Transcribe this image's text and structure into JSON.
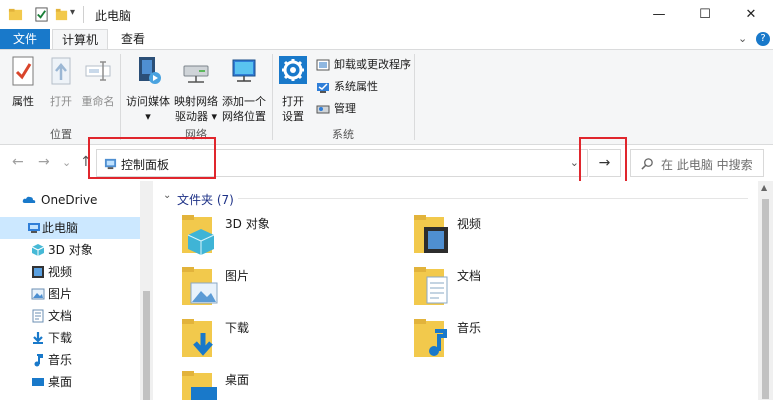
{
  "window": {
    "title": "此电脑",
    "minimize": "—",
    "maximize": "☐",
    "close": "✕"
  },
  "ribbon_tabs": {
    "file": "文件",
    "computer": "计算机",
    "view": "查看",
    "expand": "⌄",
    "help": "?"
  },
  "ribbon": {
    "location_group": {
      "label": "位置",
      "properties": "属性",
      "open": "打开",
      "rename": "重命名"
    },
    "network_group": {
      "label": "网络",
      "media_line1": "访问媒体",
      "media_line2": "▾",
      "map_line1": "映射网络",
      "map_line2": "驱动器 ▾",
      "add_line1": "添加一个",
      "add_line2": "网络位置"
    },
    "system_group": {
      "label": "系统",
      "settings_line1": "打开",
      "settings_line2": "设置",
      "uninstall": "卸载或更改程序",
      "sys_props": "系统属性",
      "manage": "管理"
    }
  },
  "navbar": {
    "back": "←",
    "forward": "→",
    "recent": "⌄",
    "up": "↑",
    "address": "控制面板",
    "address_dropdown": "⌄",
    "go": "→",
    "search_placeholder": "在 此电脑 中搜索"
  },
  "leftnav": {
    "items": [
      {
        "label": "OneDrive"
      },
      {
        "label": "此电脑"
      },
      {
        "label": "3D 对象"
      },
      {
        "label": "视频"
      },
      {
        "label": "图片"
      },
      {
        "label": "文档"
      },
      {
        "label": "下载"
      },
      {
        "label": "音乐"
      },
      {
        "label": "桌面"
      }
    ]
  },
  "content": {
    "group_header": "文件夹 (7)",
    "folders": [
      {
        "label": "3D 对象"
      },
      {
        "label": "视频"
      },
      {
        "label": "图片"
      },
      {
        "label": "文档"
      },
      {
        "label": "下载"
      },
      {
        "label": "音乐"
      },
      {
        "label": "桌面"
      }
    ]
  },
  "colors": {
    "accent": "#1979ca",
    "highlight": "#e0262d",
    "selected": "#cce8ff"
  }
}
